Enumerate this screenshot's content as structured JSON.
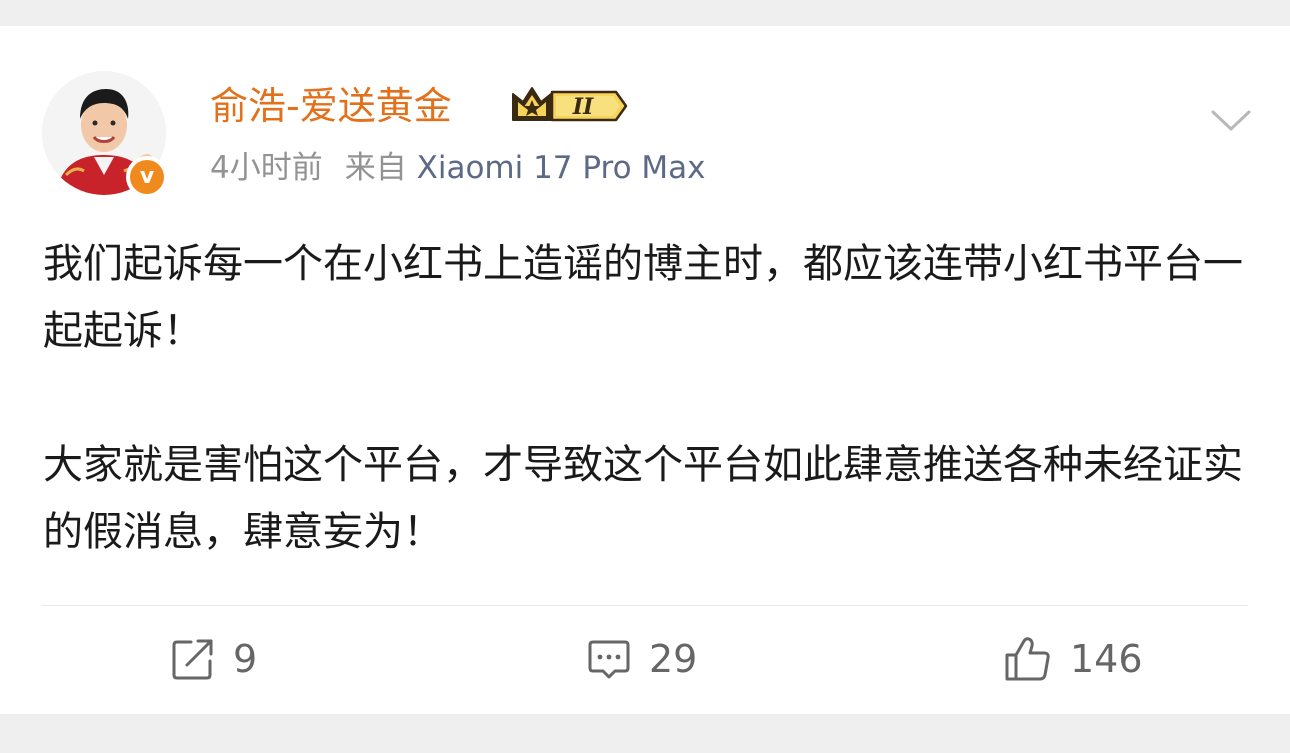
{
  "post": {
    "author": {
      "name": "俞浩-爱送黄金",
      "level_badge": "II"
    },
    "time": "4小时前",
    "source_prefix": "来自",
    "device": "Xiaomi 17 Pro Max",
    "paragraphs": [
      "我们起诉每一个在小红书上造谣的博主时，都应该连带小红书平台一起起诉！",
      "大家就是害怕这个平台，才导致这个平台如此肆意推送各种未经证实的假消息，肆意妄为！"
    ],
    "actions": {
      "reposts": "9",
      "comments": "29",
      "likes": "146"
    }
  },
  "icons": {
    "verified": "verified-v-icon",
    "badge": "crown-level-badge-icon",
    "menu": "chevron-down-icon",
    "repost": "repost-icon",
    "comment": "comment-icon",
    "like": "thumbs-up-icon"
  },
  "colors": {
    "username": "#e3701b",
    "device": "#5d6a86",
    "verified": "#f08a1d",
    "meta": "#939393"
  }
}
